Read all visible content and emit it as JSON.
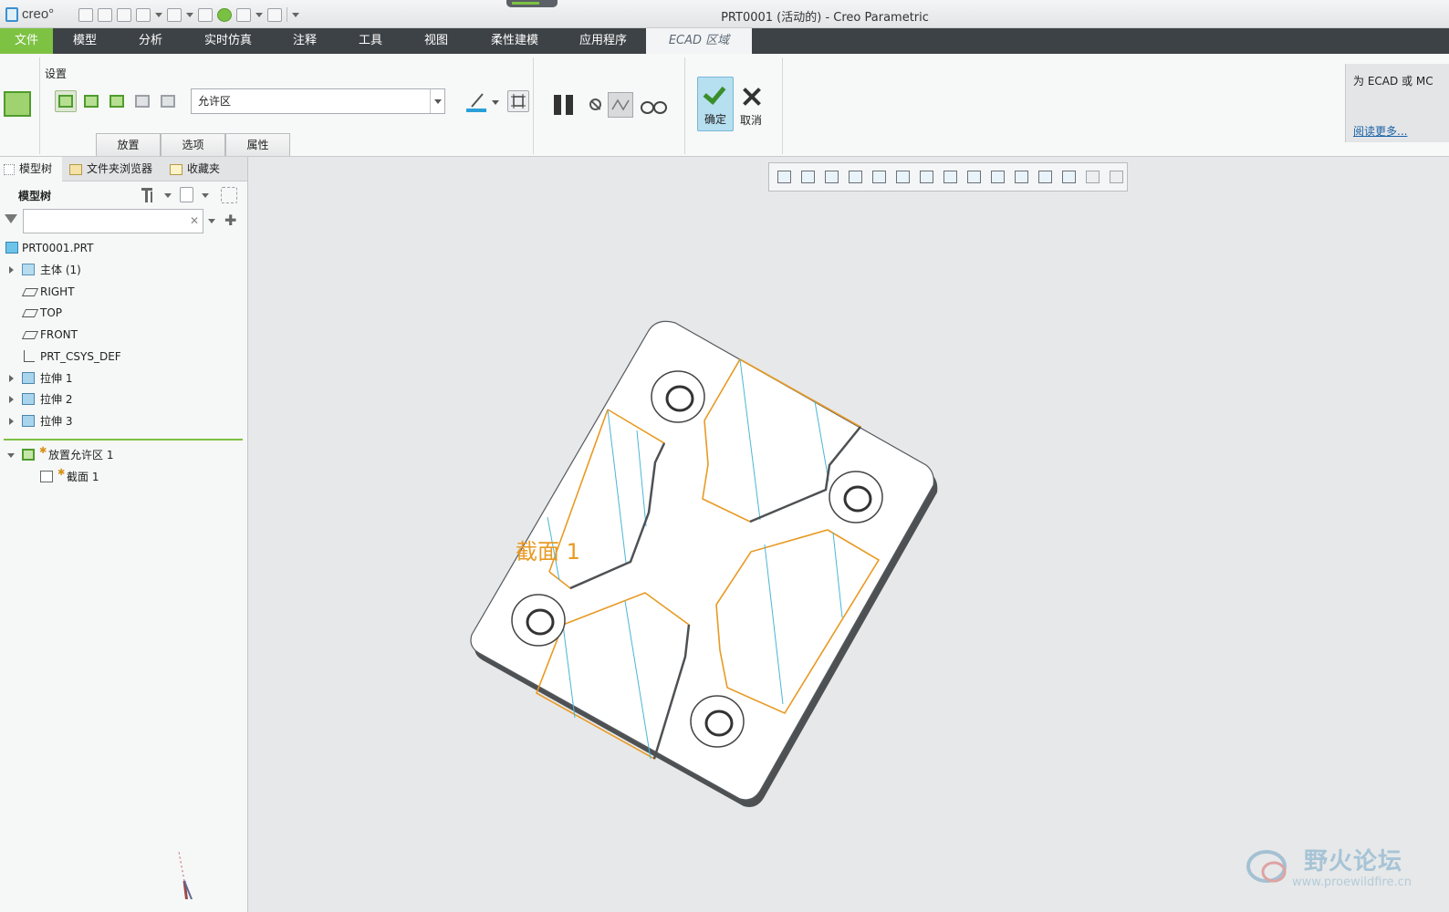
{
  "app": {
    "logo_text": "creo°",
    "window_title": "PRT0001 (活动的) - Creo Parametric"
  },
  "menu": {
    "items": [
      "文件",
      "模型",
      "分析",
      "实时仿真",
      "注释",
      "工具",
      "视图",
      "柔性建模",
      "应用程序"
    ],
    "active_tab": "ECAD 区域"
  },
  "ribbon": {
    "group_label": "设置",
    "zone_type_select": "允许区",
    "subtabs": [
      "放置",
      "选项",
      "属性"
    ],
    "ok_label": "确定",
    "cancel_label": "取消",
    "help_text": "为 ECAD 或 MC",
    "help_link": "阅读更多..."
  },
  "panel": {
    "tabs": [
      "模型树",
      "文件夹浏览器",
      "收藏夹"
    ],
    "tree_title": "模型树",
    "search_placeholder": "",
    "tree": [
      {
        "label": "PRT0001.PRT",
        "icon": "part-icon",
        "expandable": false
      },
      {
        "label": "主体 (1)",
        "icon": "body-icon",
        "expandable": true
      },
      {
        "label": "RIGHT",
        "icon": "datum-plane-icon",
        "expandable": false
      },
      {
        "label": "TOP",
        "icon": "datum-plane-icon",
        "expandable": false
      },
      {
        "label": "FRONT",
        "icon": "datum-plane-icon",
        "expandable": false
      },
      {
        "label": "PRT_CSYS_DEF",
        "icon": "csys-icon",
        "expandable": false
      },
      {
        "label": "拉伸 1",
        "icon": "extrude-icon",
        "expandable": true
      },
      {
        "label": "拉伸 2",
        "icon": "extrude-icon",
        "expandable": true
      },
      {
        "label": "拉伸 3",
        "icon": "extrude-icon",
        "expandable": true
      }
    ],
    "active_feature": {
      "label": "放置允许区 1",
      "child": "截面 1"
    }
  },
  "viewport": {
    "section_label": "截面 1",
    "watermark_title": "野火论坛",
    "watermark_url": "www.proewildfire.cn",
    "colors": {
      "section_edge": "#e89a23",
      "mesh_line": "#49b6d6",
      "background": "#e7e8e9"
    }
  }
}
